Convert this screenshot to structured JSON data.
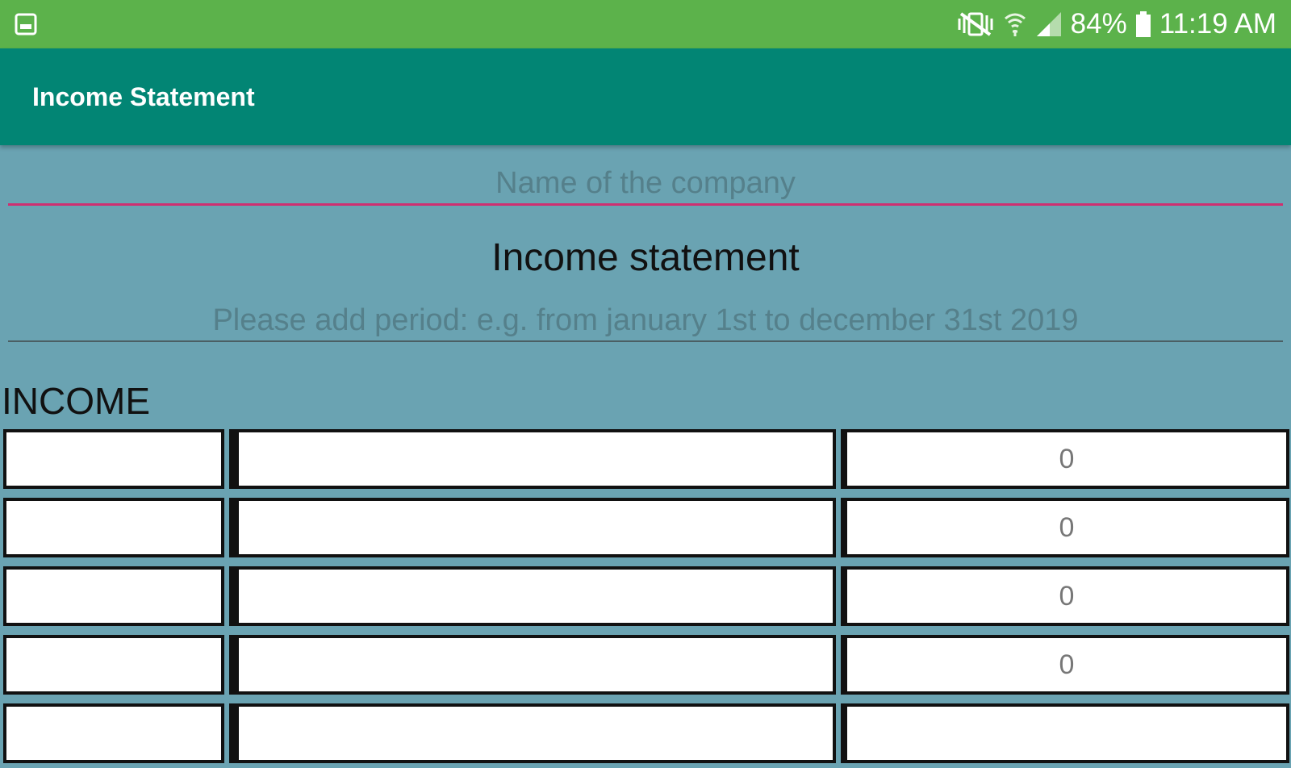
{
  "status_bar": {
    "battery_text": "84%",
    "time": "11:19 AM",
    "icons": [
      "gallery-icon",
      "vibrate-mute-icon",
      "wifi-icon",
      "cell-signal-icon",
      "battery-icon"
    ]
  },
  "app_bar": {
    "title": "Income Statement"
  },
  "form": {
    "company_placeholder": "Name of the company",
    "company_value": "",
    "statement_title": "Income statement",
    "period_placeholder": "Please add period: e.g. from january 1st to december 31st 2019",
    "period_value": ""
  },
  "income": {
    "label": "INCOME",
    "rows": [
      {
        "code": "",
        "description": "",
        "amount": "0"
      },
      {
        "code": "",
        "description": "",
        "amount": "0"
      },
      {
        "code": "",
        "description": "",
        "amount": "0"
      },
      {
        "code": "",
        "description": "",
        "amount": "0"
      },
      {
        "code": "",
        "description": "",
        "amount": ""
      }
    ]
  },
  "colors": {
    "status_bar": "#5cb24b",
    "app_bar": "#028574",
    "background": "#6aa3b2",
    "accent_underline": "#cf2f70"
  }
}
